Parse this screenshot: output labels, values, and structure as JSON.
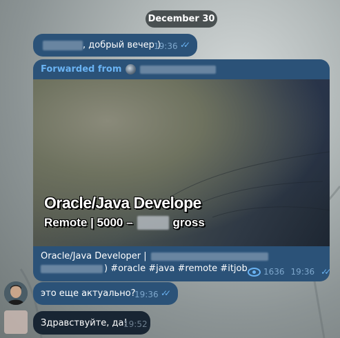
{
  "date_separator": "December 30",
  "messages": [
    {
      "text": ", добрый вечер )",
      "time": "19:36",
      "status": "read"
    },
    {
      "forwarded_label": "Forwarded from",
      "preview_title": "Oracle/Java Develope",
      "preview_subtitle_before": "Remote | 5000 –",
      "preview_subtitle_after": "gross",
      "line1": "Oracle/Java Developer |",
      "line2": ") #oracle #java #remote #itjob",
      "views": "1636",
      "time": "19:36",
      "status": "read"
    },
    {
      "text": "это еще актуально?",
      "time": "19:36",
      "status": "read"
    },
    {
      "text": "Здравствуйте, да!",
      "time": "19:52"
    }
  ],
  "colors": {
    "outgoing_bubble": "#2b5278",
    "incoming_bubble": "#182533",
    "accent": "#6ab3f3"
  },
  "icons": [
    "read-checks-icon",
    "views-eye-icon",
    "channel-avatar-icon"
  ]
}
